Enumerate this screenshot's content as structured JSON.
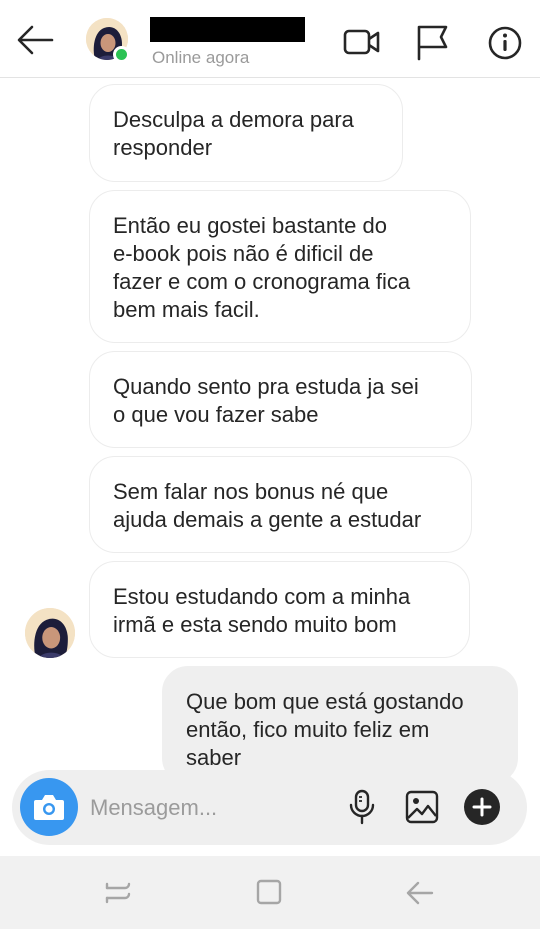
{
  "header": {
    "contact_name": "",
    "status": "Online agora"
  },
  "messages": [
    {
      "direction": "in",
      "text": "Desculpa a demora para\nresponder"
    },
    {
      "direction": "in",
      "text": "Então eu gostei bastante do\ne-book pois não é dificil de\nfazer e com o cronograma fica\nbem mais facil."
    },
    {
      "direction": "in",
      "text": "Quando sento pra estuda ja sei\no que vou fazer sabe"
    },
    {
      "direction": "in",
      "text": "Sem falar nos bonus né que\najuda demais a gente a estudar"
    },
    {
      "direction": "in",
      "text": "Estou estudando com a minha\nirmã e esta sendo muito bom"
    },
    {
      "direction": "out",
      "text": "Que bom que está gostando\nentão, fico muito feliz em\nsaber"
    }
  ],
  "composer": {
    "placeholder": "Mensagem...",
    "value": ""
  },
  "colors": {
    "accent": "#3897f0",
    "online": "#2bc253",
    "outgoing_bubble": "#efefef",
    "bubble_border": "#ececec",
    "placeholder": "#9b9b9b"
  },
  "icons": {
    "back": "arrow-left-icon",
    "video": "video-camera-icon",
    "report": "flag-icon",
    "info": "info-icon",
    "camera": "camera-icon",
    "mic": "microphone-icon",
    "gallery": "image-icon",
    "more": "plus-circle-icon"
  }
}
